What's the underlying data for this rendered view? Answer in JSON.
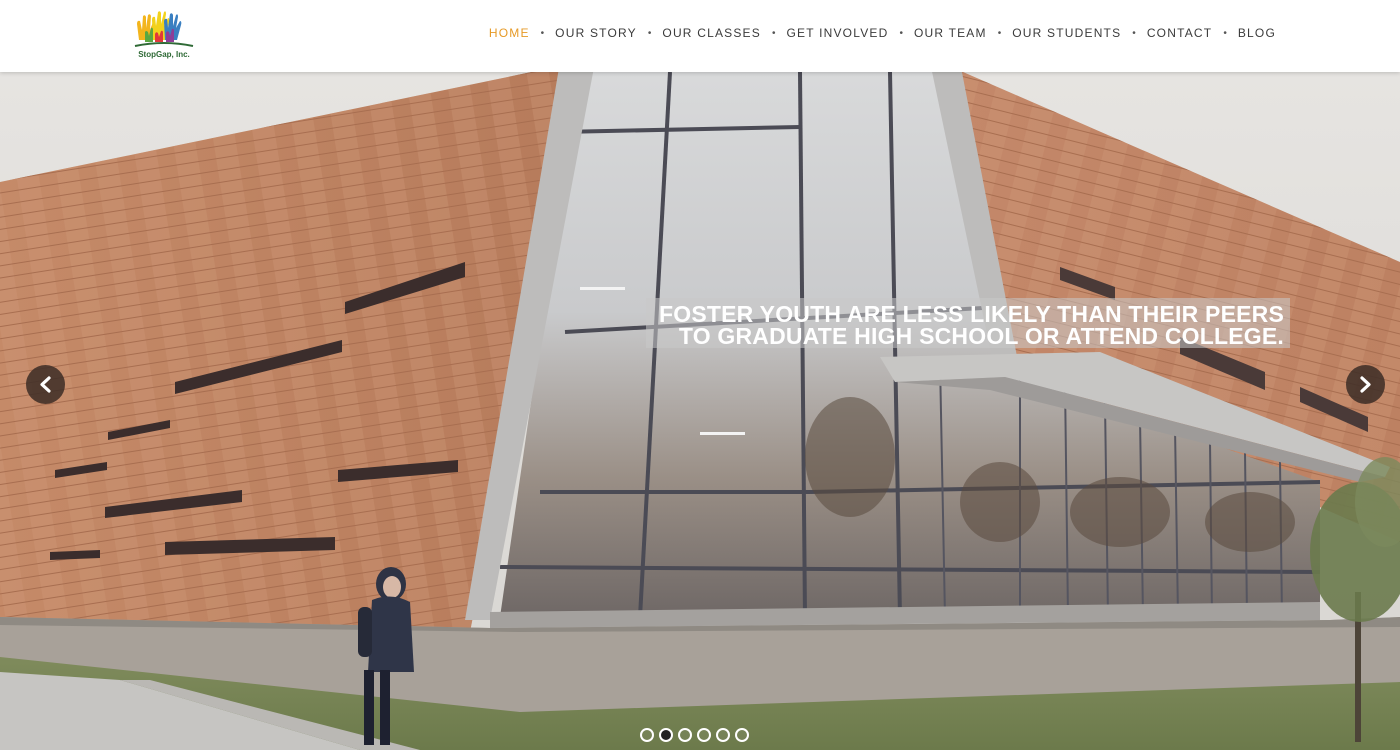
{
  "brand": {
    "logo_text": "StopGap, Inc."
  },
  "nav": {
    "items": [
      {
        "label": "HOME",
        "active": true
      },
      {
        "label": "OUR STORY",
        "active": false
      },
      {
        "label": "OUR CLASSES",
        "active": false
      },
      {
        "label": "GET INVOLVED",
        "active": false
      },
      {
        "label": "OUR TEAM",
        "active": false
      },
      {
        "label": "OUR STUDENTS",
        "active": false
      },
      {
        "label": "CONTACT",
        "active": false
      },
      {
        "label": "BLOG",
        "active": false
      }
    ],
    "separator": "•",
    "active_color": "#e69a27"
  },
  "slider": {
    "caption_line1": "FOSTER YOUTH ARE LESS LIKELY THAN THEIR PEERS",
    "caption_line2": "TO GRADUATE HIGH SCHOOL OR ATTEND COLLEGE.",
    "prev_icon": "chevron-left-icon",
    "next_icon": "chevron-right-icon",
    "slide_count": 6,
    "active_slide": 2
  }
}
